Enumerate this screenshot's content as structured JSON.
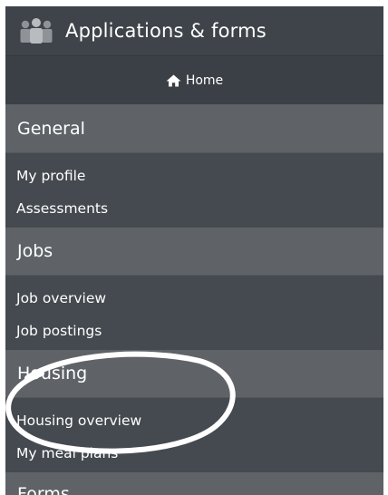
{
  "header": {
    "title": "Applications & forms",
    "icon": "people-group-icon"
  },
  "home": {
    "label": "Home",
    "icon": "home-icon"
  },
  "sections": [
    {
      "title": "General",
      "items": [
        "My profile",
        "Assessments"
      ]
    },
    {
      "title": "Jobs",
      "items": [
        "Job overview",
        "Job postings"
      ]
    },
    {
      "title": "Housing",
      "items": [
        "Housing overview",
        "My meal plans"
      ]
    },
    {
      "title": "Forms",
      "items": []
    }
  ],
  "colors": {
    "panel_bg": "#444a50",
    "section_bg": "#5f6368",
    "text": "#ffffff",
    "annotation": "#ffffff"
  }
}
